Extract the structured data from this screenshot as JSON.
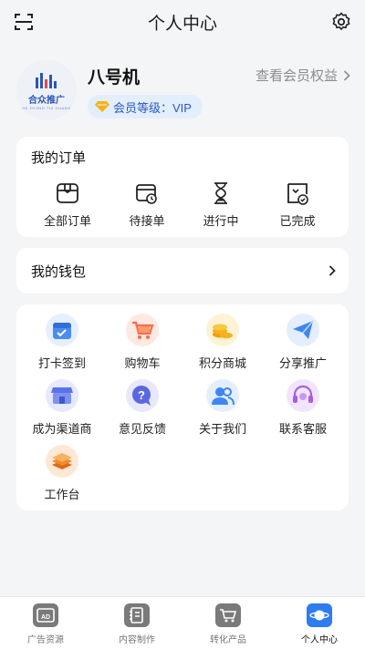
{
  "header": {
    "title": "个人中心"
  },
  "profile": {
    "avatar_text": "合众推广",
    "avatar_subtext": "HE ZHONG TUI GUANG",
    "username": "八号机",
    "member_level": "会员等级：VIP",
    "member_link": "查看会员权益"
  },
  "orders": {
    "title": "我的订单",
    "items": [
      {
        "label": "全部订单",
        "icon": "box-icon"
      },
      {
        "label": "待接单",
        "icon": "calendar-clock-icon"
      },
      {
        "label": "进行中",
        "icon": "hourglass-icon"
      },
      {
        "label": "已完成",
        "icon": "completed-check-icon"
      }
    ]
  },
  "wallet": {
    "label": "我的钱包"
  },
  "services": {
    "items": [
      {
        "label": "打卡签到",
        "icon": "checkin-calendar-icon",
        "color": "#4a8cf0"
      },
      {
        "label": "购物车",
        "icon": "cart-icon",
        "color": "#ff6a4a"
      },
      {
        "label": "积分商城",
        "icon": "coins-icon",
        "color": "#f5b21c"
      },
      {
        "label": "分享推广",
        "icon": "paper-plane-icon",
        "color": "#3f86f2"
      },
      {
        "label": "成为渠道商",
        "icon": "storefront-icon",
        "color": "#5a73e8"
      },
      {
        "label": "意见反馈",
        "icon": "feedback-bubble-icon",
        "color": "#5b67e0"
      },
      {
        "label": "关于我们",
        "icon": "people-icon",
        "color": "#3f86f2"
      },
      {
        "label": "联系客服",
        "icon": "headset-icon",
        "color": "#a45ee8"
      },
      {
        "label": "工作台",
        "icon": "layers-icon",
        "color": "#f08a2a"
      }
    ]
  },
  "tabbar": {
    "items": [
      {
        "label": "广告资源",
        "icon": "ad-icon",
        "active": false
      },
      {
        "label": "内容制作",
        "icon": "notebook-icon",
        "active": false
      },
      {
        "label": "转化产品",
        "icon": "cart-tab-icon",
        "active": false
      },
      {
        "label": "个人中心",
        "icon": "planet-icon",
        "active": true
      }
    ]
  }
}
